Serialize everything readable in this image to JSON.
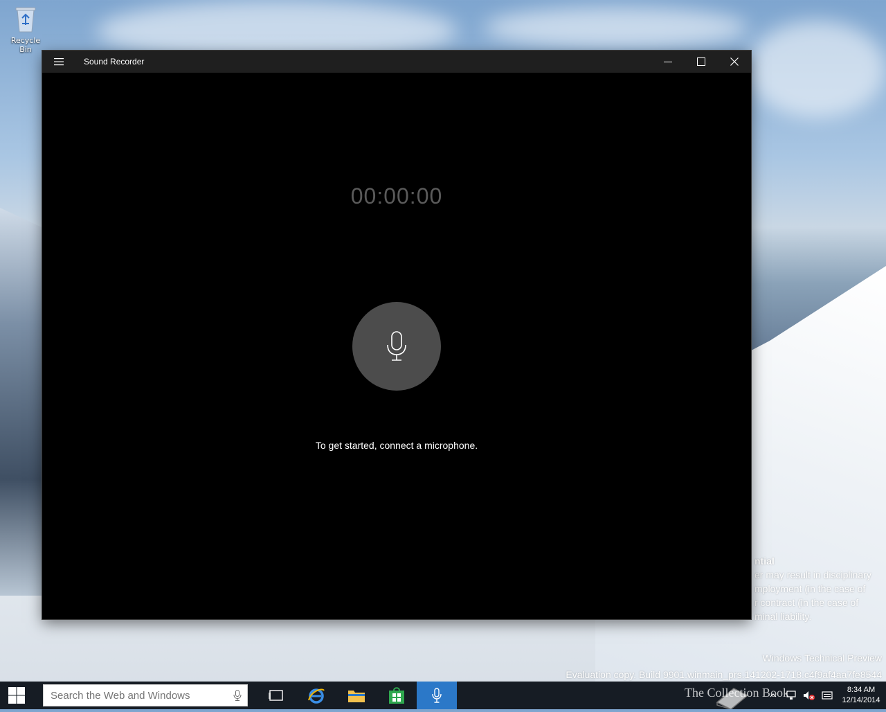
{
  "desktop": {
    "recycle_bin_label": "Recycle Bin",
    "watermark": {
      "confidential_title": "ntial",
      "confidential_lines": [
        "er may result in disciplinary",
        "mployment (in the case of",
        "r contract (in the case of",
        "minal liability."
      ],
      "edition": "Windows Technical Preview",
      "build": "Evaluation copy. Build 9901.winmain_prs.141202-1718.c4f9af4aa7fe8544"
    }
  },
  "window": {
    "title": "Sound Recorder",
    "timer": "00:00:00",
    "message": "To get started, connect a microphone."
  },
  "taskbar": {
    "search_placeholder": "Search the Web and Windows",
    "time": "8:34 AM",
    "date": "12/14/2014",
    "overlay_text": "The Collection Book",
    "active_app": "Sound Recorder"
  },
  "colors": {
    "window_bg": "#000000",
    "titlebar_bg": "#1f1f1f",
    "mic_button_bg": "#4c4c4c",
    "timer_color": "#5a5a5a",
    "taskbar_bg": "#161c24",
    "active_app_bg": "#2b78c8"
  }
}
